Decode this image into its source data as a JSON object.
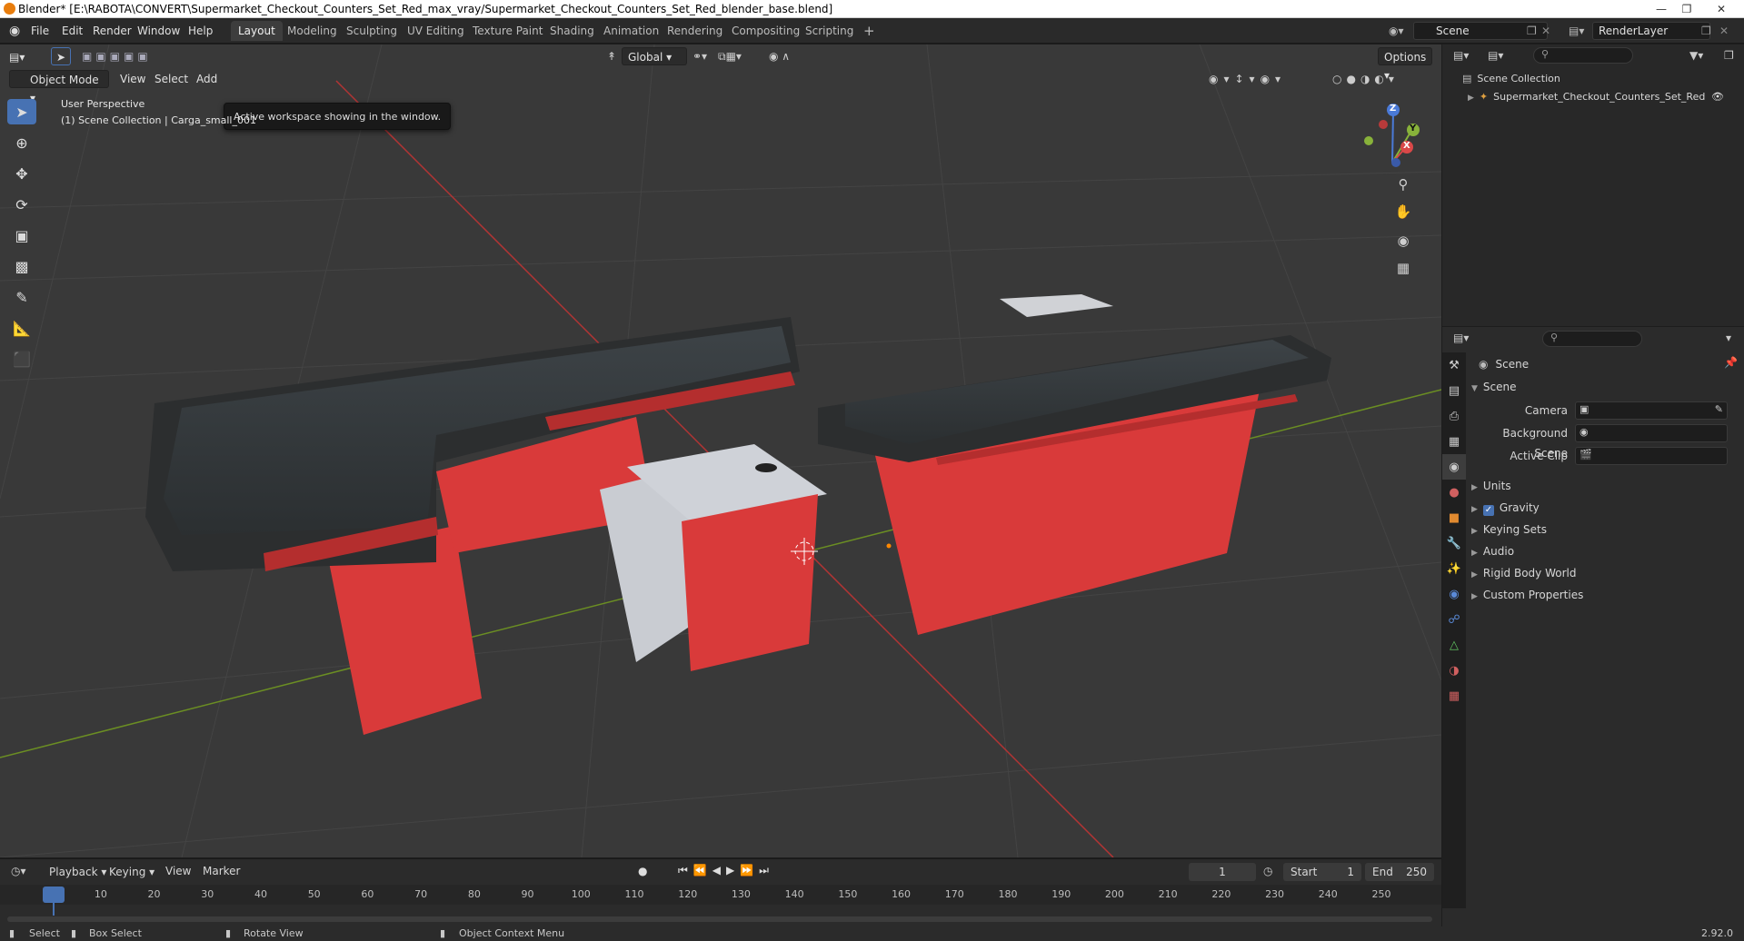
{
  "title_bar": {
    "text": "Blender* [E:\\RABOTA\\CONVERT\\Supermarket_Checkout_Counters_Set_Red_max_vray/Supermarket_Checkout_Counters_Set_Red_blender_base.blend]"
  },
  "menu": [
    "File",
    "Edit",
    "Render",
    "Window",
    "Help"
  ],
  "workspaces": [
    "Layout",
    "Modeling",
    "Sculpting",
    "UV Editing",
    "Texture Paint",
    "Shading",
    "Animation",
    "Rendering",
    "Compositing",
    "Scripting"
  ],
  "active_workspace": "Layout",
  "scene_field": "Scene",
  "renderlayer_field": "RenderLayer",
  "viewport": {
    "mode": "Object Mode",
    "menus": [
      "View",
      "Select",
      "Add"
    ],
    "transform": "Global",
    "options": "Options",
    "tooltip": "Active workspace showing in the window.",
    "overlay_line1": "User Perspective",
    "overlay_line2": "(1) Scene Collection | Carga_small_001",
    "gizmo": {
      "x": "X",
      "y": "Y",
      "z": "Z"
    }
  },
  "outliner": {
    "root": "Scene Collection",
    "items": [
      "Supermarket_Checkout_Counters_Set_Red"
    ]
  },
  "properties": {
    "header": "Scene",
    "section": "Scene",
    "fields": [
      {
        "label": "Camera"
      },
      {
        "label": "Background Scene"
      },
      {
        "label": "Active Clip"
      }
    ],
    "panels": [
      "Units",
      "Gravity",
      "Keying Sets",
      "Audio",
      "Rigid Body World",
      "Custom Properties"
    ],
    "gravity_checked": true
  },
  "timeline": {
    "menus": [
      "Playback",
      "Keying",
      "View",
      "Marker"
    ],
    "current_frame": "1",
    "start_label": "Start",
    "start": "1",
    "end_label": "End",
    "end": "250",
    "ticks": [
      "1",
      "10",
      "20",
      "30",
      "40",
      "50",
      "60",
      "70",
      "80",
      "90",
      "100",
      "110",
      "120",
      "130",
      "140",
      "150",
      "160",
      "170",
      "180",
      "190",
      "200",
      "210",
      "220",
      "230",
      "240",
      "250"
    ]
  },
  "status_bar": {
    "items": [
      "Select",
      "Box Select",
      "Rotate View",
      "Object Context Menu"
    ],
    "version": "2.92.0"
  },
  "colors": {
    "accent": "#4772b3",
    "counter_red": "#d93a3a",
    "viewport_bg": "#393939"
  }
}
